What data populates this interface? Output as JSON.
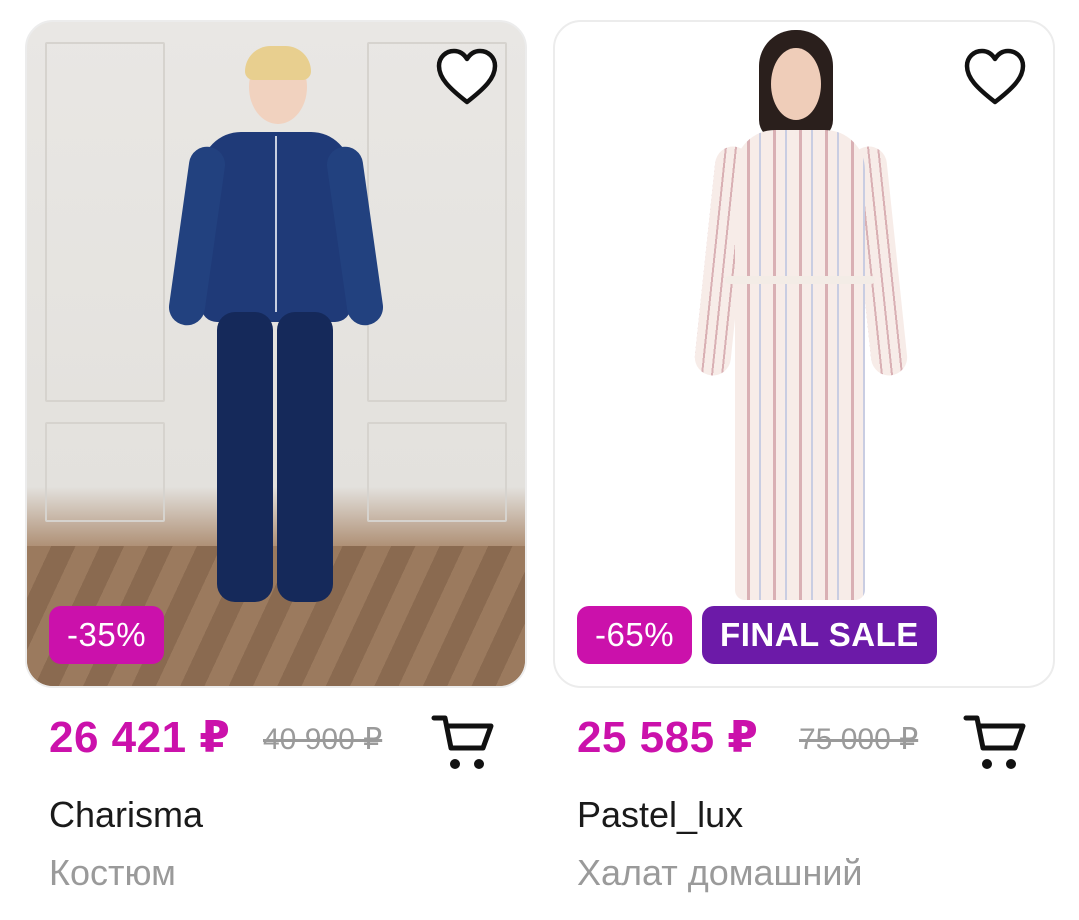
{
  "colors": {
    "accent": "#cb11ab",
    "final_sale": "#6c1aa8",
    "old_price": "#9a9a9a"
  },
  "products": [
    {
      "discount": "-35%",
      "final_sale": "",
      "price": "26 421 ₽",
      "old_price": "40 900 ₽",
      "brand": "Charisma",
      "name": "Костюм",
      "image": "woman-in-blue-velvet-tracksuit",
      "favorite_icon": "heart-outline-icon",
      "cart_icon": "cart-icon"
    },
    {
      "discount": "-65%",
      "final_sale": "FINAL SALE",
      "price": "25 585 ₽",
      "old_price": "75 000 ₽",
      "brand": "Pastel_lux",
      "name": "Халат домашний",
      "image": "woman-in-floral-striped-robe",
      "favorite_icon": "heart-outline-icon",
      "cart_icon": "cart-icon"
    }
  ]
}
